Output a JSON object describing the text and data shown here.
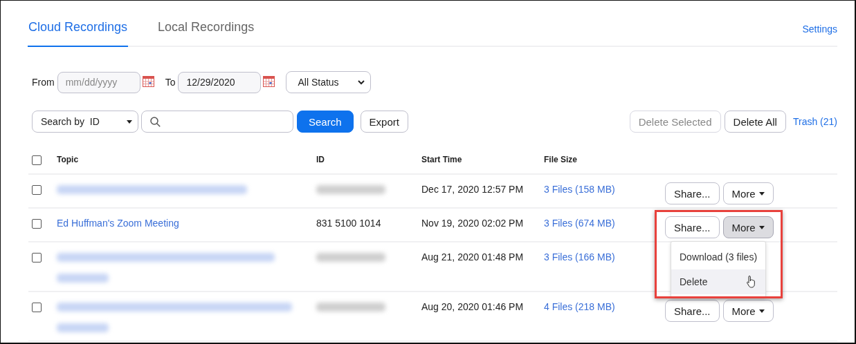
{
  "tabs": [
    {
      "label": "Cloud Recordings",
      "selected": true
    },
    {
      "label": "Local Recordings",
      "selected": false
    }
  ],
  "settings_link": "Settings",
  "filters": {
    "from_label": "From",
    "from": {
      "placeholder": "mm/dd/yyyy"
    },
    "to_label": "To",
    "to": {
      "value": "12/29/2020"
    },
    "status": "All Status"
  },
  "search": {
    "type": "Search by  ID",
    "button": "Search",
    "export": "Export"
  },
  "bulk": [
    {
      "label": "Delete Selected",
      "disabled": true
    },
    {
      "label": "Delete All",
      "disabled": false
    }
  ],
  "trash": "Trash (21)",
  "table": {
    "select_all": {
      "checked": false
    },
    "columns": [
      "Topic",
      "ID",
      "Start Time",
      "File Size"
    ],
    "rows": [
      {
        "checked": false,
        "topic": {
          "kind": "blurred"
        },
        "id": {
          "kind": "blurred"
        },
        "start_time": "Dec 17, 2020 12:57 PM",
        "files": "3 Files (158 MB)",
        "actions": {
          "share": "Share...",
          "more": "More",
          "pressed": false
        }
      },
      {
        "checked": false,
        "topic": {
          "kind": "link",
          "text": "Ed Huffman's Zoom Meeting"
        },
        "id": {
          "kind": "text",
          "text": "831 5100 1014"
        },
        "start_time": "Nov 19, 2020 02:02 PM",
        "files": "3 Files (674 MB)",
        "actions": {
          "share": "Share...",
          "more": "More",
          "pressed": true
        },
        "menu": {
          "items": [
            {
              "label": "Download (3 files)",
              "selected": false
            },
            {
              "label": "Delete",
              "selected": true
            }
          ]
        },
        "annotation": {
          "kind": "highlight-box",
          "color": "#e8413c"
        }
      },
      {
        "checked": false,
        "topic": {
          "kind": "blurred-two-line"
        },
        "id": {
          "kind": "blurred"
        },
        "start_time": "Aug 21, 2020 01:48 PM",
        "files": "3 Files (166 MB)"
      },
      {
        "checked": false,
        "topic": {
          "kind": "blurred-two-line"
        },
        "id": {
          "kind": "blurred"
        },
        "start_time": "Aug 20, 2020 01:46 PM",
        "files": "4 Files (218 MB)",
        "actions": {
          "share": "Share...",
          "more": "More",
          "pressed": false
        }
      }
    ]
  }
}
